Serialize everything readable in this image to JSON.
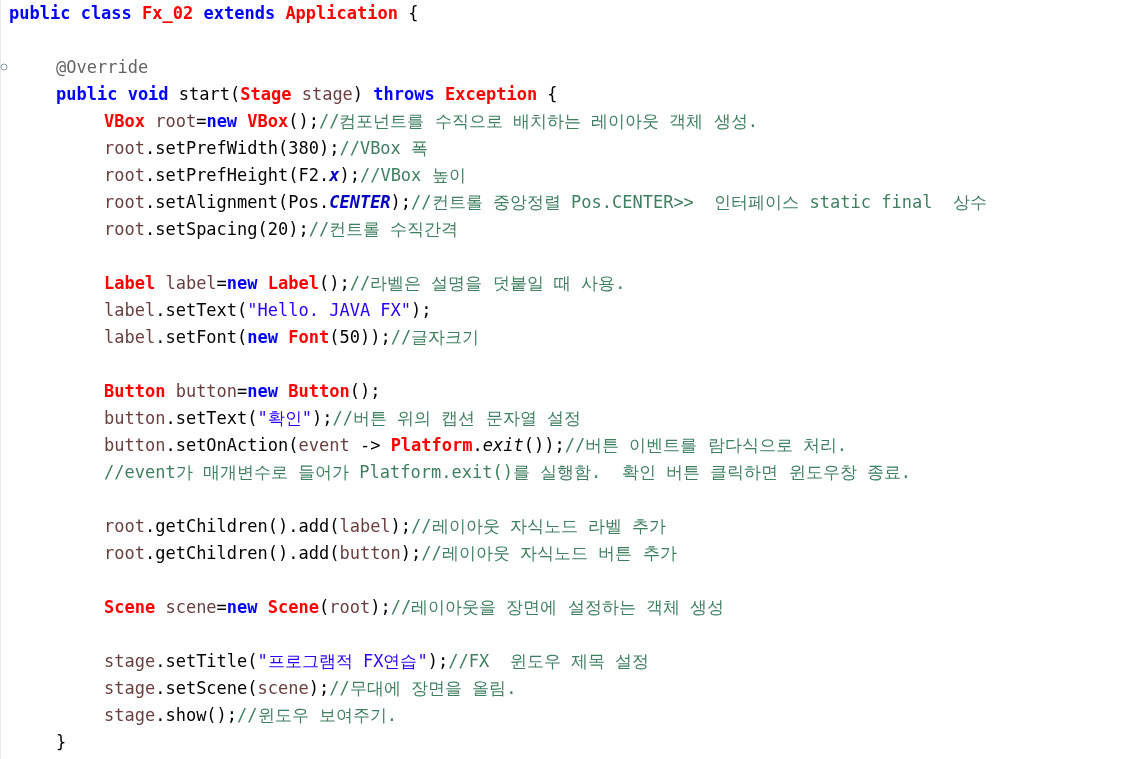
{
  "editor": {
    "lines": [
      {
        "kind": "class",
        "tokens": [
          {
            "kind": "keyword",
            "text": "public class "
          },
          {
            "kind": "type",
            "text": "Fx_02 "
          },
          {
            "kind": "keyword",
            "text": "extends "
          },
          {
            "kind": "type",
            "text": "Application "
          },
          {
            "kind": "plain",
            "text": "{"
          }
        ]
      },
      {
        "kind": "blank"
      },
      {
        "kind": "method",
        "marker": true,
        "tokens": [
          {
            "kind": "annotation",
            "text": "@Override"
          }
        ]
      },
      {
        "kind": "method",
        "tokens": [
          {
            "kind": "keyword",
            "text": "public void "
          },
          {
            "kind": "plain",
            "text": "start("
          },
          {
            "kind": "type",
            "text": "Stage "
          },
          {
            "kind": "var",
            "text": "stage"
          },
          {
            "kind": "plain",
            "text": ") "
          },
          {
            "kind": "keyword",
            "text": "throws "
          },
          {
            "kind": "type",
            "text": "Exception "
          },
          {
            "kind": "plain",
            "text": "{"
          }
        ]
      },
      {
        "kind": "statement",
        "tokens": [
          {
            "kind": "type",
            "text": "VBox "
          },
          {
            "kind": "var",
            "text": "root"
          },
          {
            "kind": "plain",
            "text": "="
          },
          {
            "kind": "keyword",
            "text": "new "
          },
          {
            "kind": "type",
            "text": "VBox"
          },
          {
            "kind": "plain",
            "text": "();"
          },
          {
            "kind": "comment",
            "text": "//컴포넌트를 수직으로 배치하는 레이아웃 객체 생성."
          }
        ]
      },
      {
        "kind": "statement",
        "tokens": [
          {
            "kind": "var",
            "text": "root"
          },
          {
            "kind": "plain",
            "text": ".setPrefWidth(380);"
          },
          {
            "kind": "comment",
            "text": "//VBox 폭"
          }
        ]
      },
      {
        "kind": "statement",
        "tokens": [
          {
            "kind": "var",
            "text": "root"
          },
          {
            "kind": "plain",
            "text": ".setPrefHeight(F2."
          },
          {
            "kind": "field",
            "text": "x"
          },
          {
            "kind": "plain",
            "text": ");"
          },
          {
            "kind": "comment",
            "text": "//VBox 높이"
          }
        ]
      },
      {
        "kind": "statement",
        "tokens": [
          {
            "kind": "var",
            "text": "root"
          },
          {
            "kind": "plain",
            "text": ".setAlignment(Pos."
          },
          {
            "kind": "field",
            "text": "CENTER"
          },
          {
            "kind": "plain",
            "text": ");"
          },
          {
            "kind": "comment",
            "text": "//컨트롤 중앙정렬 Pos.CENTER>>  인터페이스 static final  상수"
          }
        ]
      },
      {
        "kind": "statement",
        "tokens": [
          {
            "kind": "var",
            "text": "root"
          },
          {
            "kind": "plain",
            "text": ".setSpacing(20);"
          },
          {
            "kind": "comment",
            "text": "//컨트롤 수직간격"
          }
        ]
      },
      {
        "kind": "blank"
      },
      {
        "kind": "statement",
        "tokens": [
          {
            "kind": "type",
            "text": "Label "
          },
          {
            "kind": "var",
            "text": "label"
          },
          {
            "kind": "plain",
            "text": "="
          },
          {
            "kind": "keyword",
            "text": "new "
          },
          {
            "kind": "type",
            "text": "Label"
          },
          {
            "kind": "plain",
            "text": "();"
          },
          {
            "kind": "comment",
            "text": "//라벨은 설명을 덧붙일 때 사용."
          }
        ]
      },
      {
        "kind": "statement",
        "tokens": [
          {
            "kind": "var",
            "text": "label"
          },
          {
            "kind": "plain",
            "text": ".setText("
          },
          {
            "kind": "string",
            "text": "\"Hello. JAVA FX\""
          },
          {
            "kind": "plain",
            "text": ");"
          }
        ]
      },
      {
        "kind": "statement",
        "tokens": [
          {
            "kind": "var",
            "text": "label"
          },
          {
            "kind": "plain",
            "text": ".setFont("
          },
          {
            "kind": "keyword",
            "text": "new "
          },
          {
            "kind": "type",
            "text": "Font"
          },
          {
            "kind": "plain",
            "text": "(50));"
          },
          {
            "kind": "comment",
            "text": "//글자크기"
          }
        ]
      },
      {
        "kind": "blank"
      },
      {
        "kind": "statement",
        "tokens": [
          {
            "kind": "type",
            "text": "Button "
          },
          {
            "kind": "var",
            "text": "button"
          },
          {
            "kind": "plain",
            "text": "="
          },
          {
            "kind": "keyword",
            "text": "new "
          },
          {
            "kind": "type",
            "text": "Button"
          },
          {
            "kind": "plain",
            "text": "();"
          }
        ]
      },
      {
        "kind": "statement",
        "tokens": [
          {
            "kind": "var",
            "text": "button"
          },
          {
            "kind": "plain",
            "text": ".setText("
          },
          {
            "kind": "string",
            "text": "\"확인\""
          },
          {
            "kind": "plain",
            "text": ");"
          },
          {
            "kind": "comment",
            "text": "//버튼 위의 캡션 문자열 설정"
          }
        ]
      },
      {
        "kind": "statement",
        "tokens": [
          {
            "kind": "var",
            "text": "button"
          },
          {
            "kind": "plain",
            "text": ".setOnAction("
          },
          {
            "kind": "var",
            "text": "event"
          },
          {
            "kind": "plain",
            "text": " -> "
          },
          {
            "kind": "type",
            "text": "Platform"
          },
          {
            "kind": "plain",
            "text": "."
          },
          {
            "kind": "static",
            "text": "exit"
          },
          {
            "kind": "plain",
            "text": "());"
          },
          {
            "kind": "comment",
            "text": "//버튼 이벤트를 람다식으로 처리."
          }
        ]
      },
      {
        "kind": "statement",
        "tokens": [
          {
            "kind": "comment",
            "text": "//event가 매개변수로 들어가 Platform.exit()를 실행함.  확인 버튼 클릭하면 윈도우창 종료."
          }
        ]
      },
      {
        "kind": "blank"
      },
      {
        "kind": "statement",
        "tokens": [
          {
            "kind": "var",
            "text": "root"
          },
          {
            "kind": "plain",
            "text": ".getChildren().add("
          },
          {
            "kind": "var",
            "text": "label"
          },
          {
            "kind": "plain",
            "text": ");"
          },
          {
            "kind": "comment",
            "text": "//레이아웃 자식노드 라벨 추가"
          }
        ]
      },
      {
        "kind": "statement",
        "tokens": [
          {
            "kind": "var",
            "text": "root"
          },
          {
            "kind": "plain",
            "text": ".getChildren().add("
          },
          {
            "kind": "var",
            "text": "button"
          },
          {
            "kind": "plain",
            "text": ");"
          },
          {
            "kind": "comment",
            "text": "//레이아웃 자식노드 버튼 추가"
          }
        ]
      },
      {
        "kind": "blank"
      },
      {
        "kind": "statement",
        "tokens": [
          {
            "kind": "type",
            "text": "Scene "
          },
          {
            "kind": "var",
            "text": "scene"
          },
          {
            "kind": "plain",
            "text": "="
          },
          {
            "kind": "keyword",
            "text": "new "
          },
          {
            "kind": "type",
            "text": "Scene"
          },
          {
            "kind": "plain",
            "text": "("
          },
          {
            "kind": "var",
            "text": "root"
          },
          {
            "kind": "plain",
            "text": ");"
          },
          {
            "kind": "comment",
            "text": "//레이아웃을 장면에 설정하는 객체 생성"
          }
        ]
      },
      {
        "kind": "blank"
      },
      {
        "kind": "statement",
        "tokens": [
          {
            "kind": "var",
            "text": "stage"
          },
          {
            "kind": "plain",
            "text": ".setTitle("
          },
          {
            "kind": "string",
            "text": "\"프로그램적 FX연습\""
          },
          {
            "kind": "plain",
            "text": ");"
          },
          {
            "kind": "comment",
            "text": "//FX  윈도우 제목 설정"
          }
        ]
      },
      {
        "kind": "statement",
        "tokens": [
          {
            "kind": "var",
            "text": "stage"
          },
          {
            "kind": "plain",
            "text": ".setScene("
          },
          {
            "kind": "var",
            "text": "scene"
          },
          {
            "kind": "plain",
            "text": ");"
          },
          {
            "kind": "comment",
            "text": "//무대에 장면을 올림."
          }
        ]
      },
      {
        "kind": "statement",
        "tokens": [
          {
            "kind": "var",
            "text": "stage"
          },
          {
            "kind": "plain",
            "text": ".show();"
          },
          {
            "kind": "comment",
            "text": "//윈도우 보여주기."
          }
        ]
      },
      {
        "kind": "method",
        "tokens": [
          {
            "kind": "plain",
            "text": "}"
          }
        ]
      }
    ]
  }
}
